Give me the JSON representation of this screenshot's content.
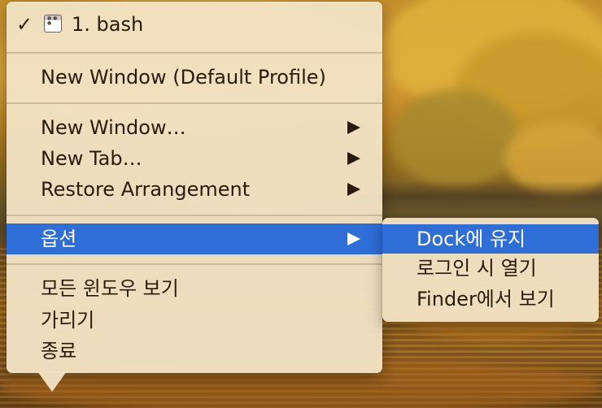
{
  "colors": {
    "menu_bg": "#f1e2c4",
    "highlight": "#2f6ed6",
    "text": "#2a1c0c"
  },
  "menu": {
    "current": {
      "check": "✓",
      "icon": "terminal-window-icon",
      "label": "1. bash"
    },
    "items": [
      {
        "label": "New Window (Default Profile)"
      },
      {
        "label": "New Window…"
      },
      {
        "label": "New Tab…"
      },
      {
        "label": "Restore Arrangement"
      },
      {
        "label": "옵션",
        "selected": true
      },
      {
        "label": "모든 윈도우 보기"
      },
      {
        "label": "가리기"
      },
      {
        "label": "종료"
      }
    ]
  },
  "submenu": {
    "items": [
      {
        "label": "Dock에 유지",
        "selected": true
      },
      {
        "label": "로그인 시 열기"
      },
      {
        "label": "Finder에서 보기"
      }
    ]
  }
}
